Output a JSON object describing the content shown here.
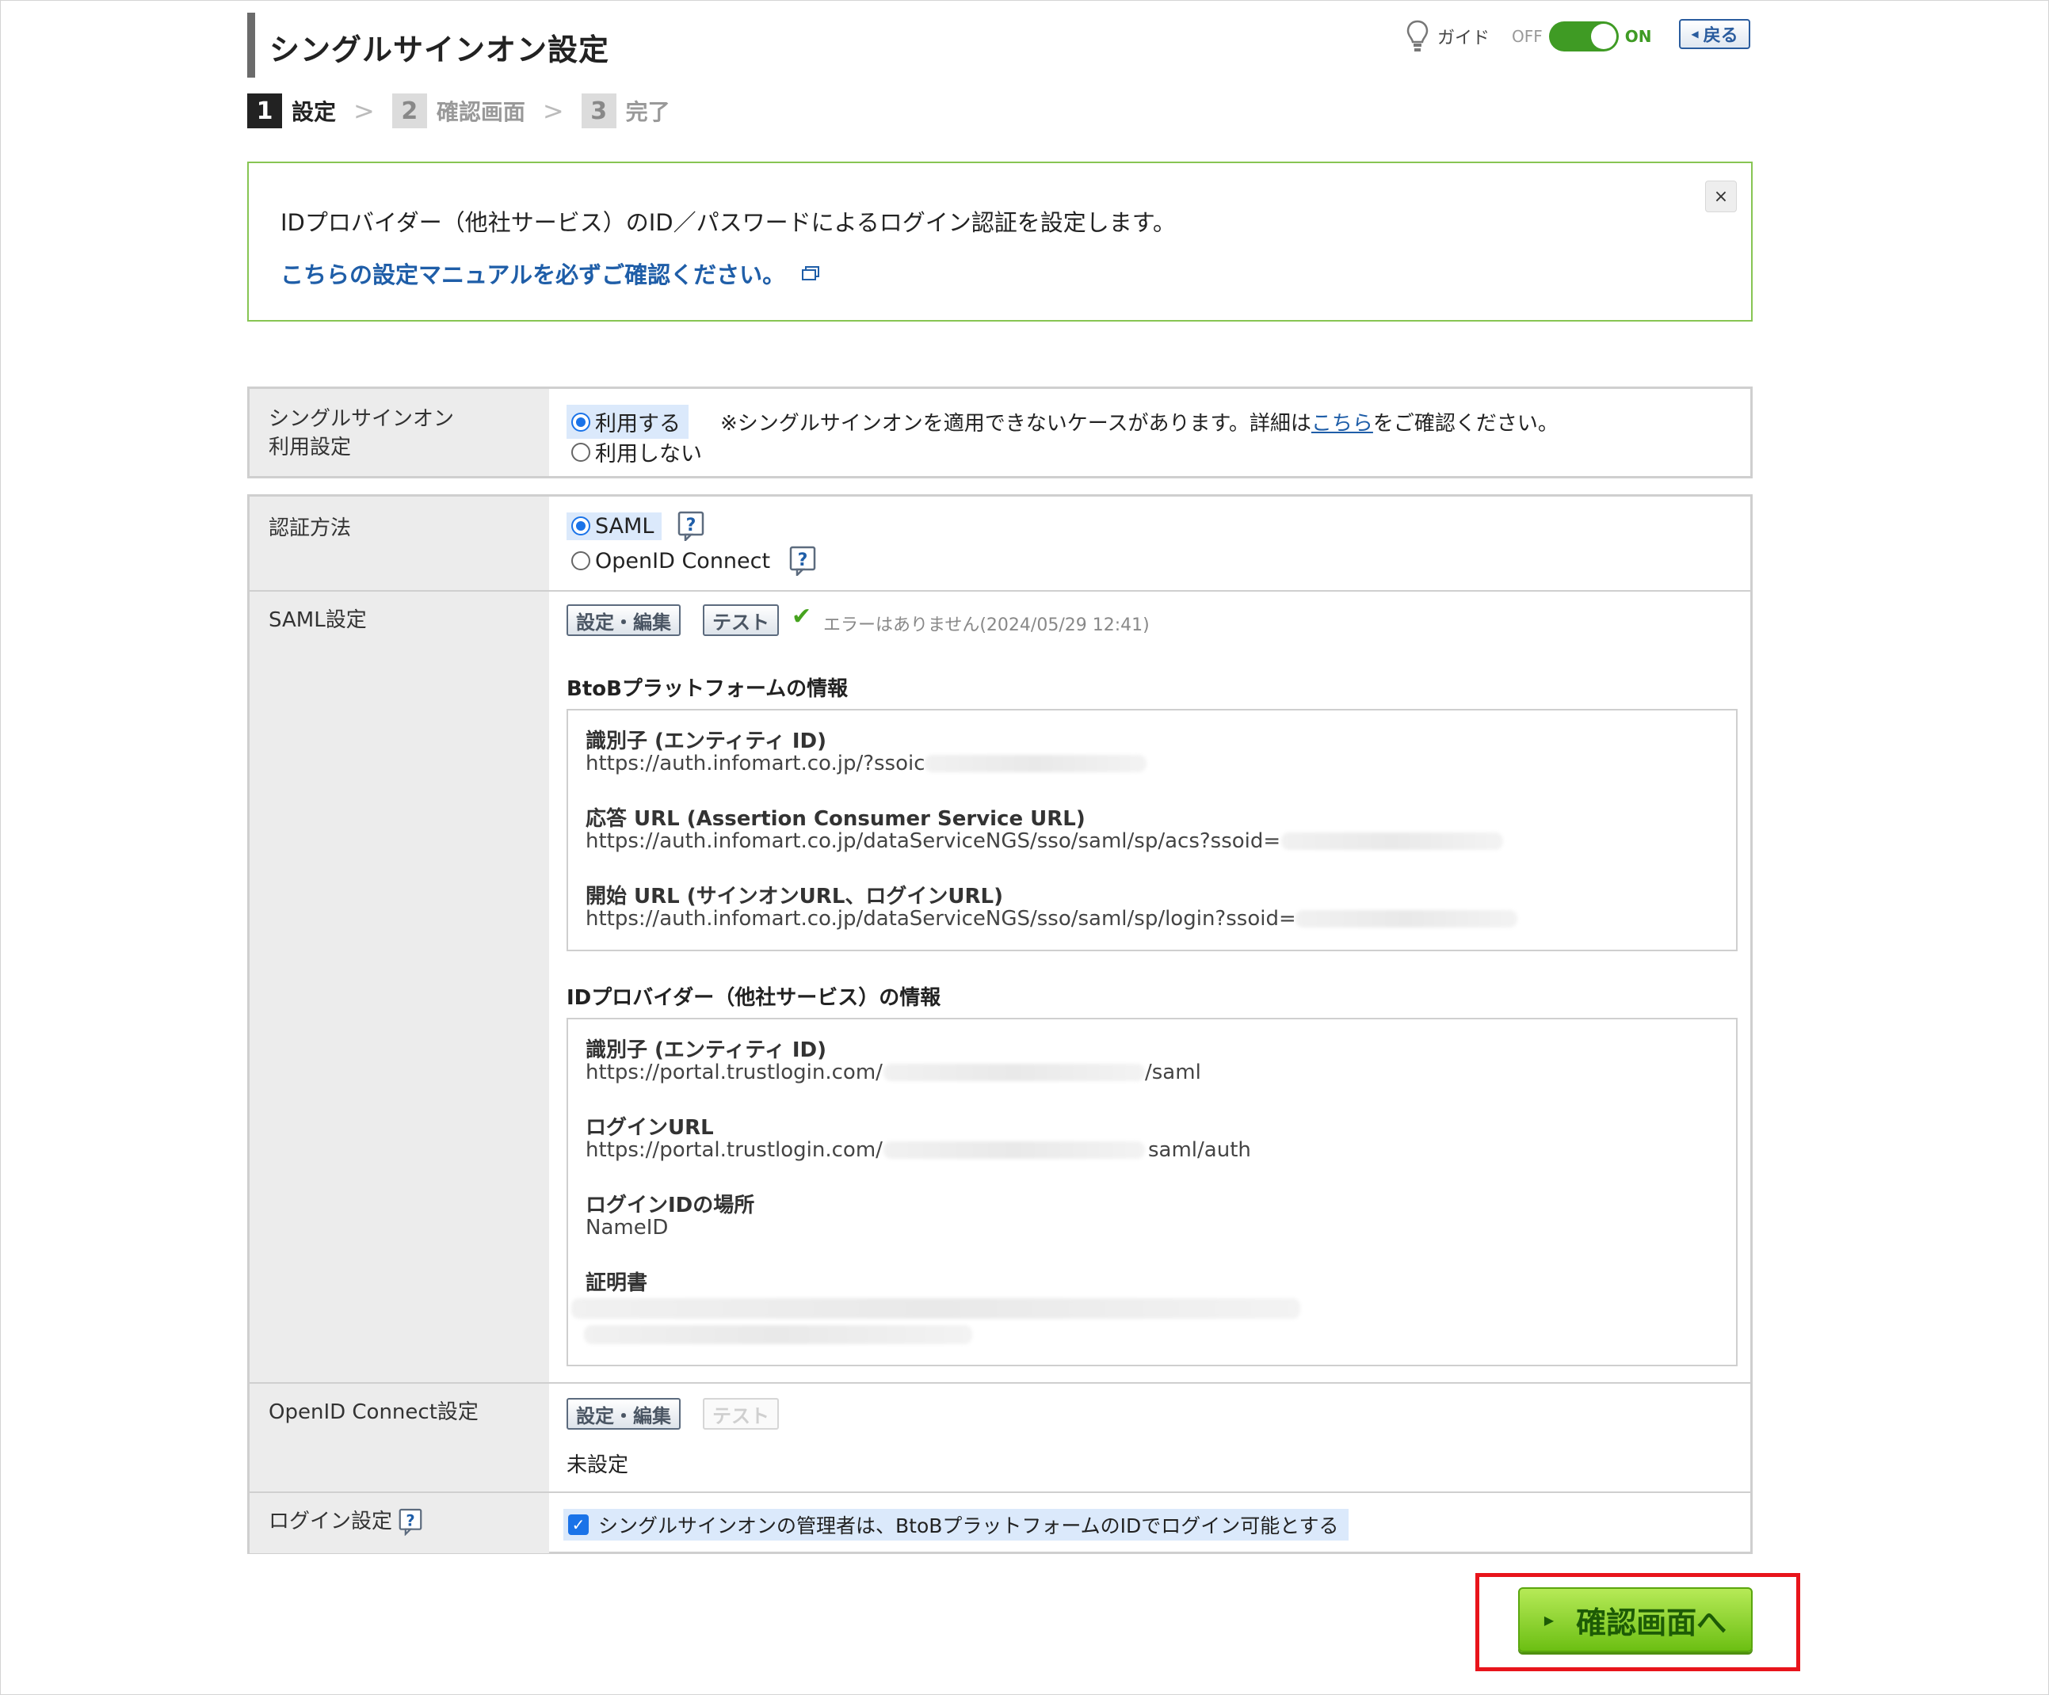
{
  "page": {
    "title": "シングルサインオン設定",
    "guide_label": "ガイド",
    "guide_off": "OFF",
    "guide_on": "ON",
    "back_label": "戻る"
  },
  "steps": [
    {
      "num": "1",
      "label": "設定",
      "active": true
    },
    {
      "num": "2",
      "label": "確認画面",
      "active": false
    },
    {
      "num": "3",
      "label": "完了",
      "active": false
    }
  ],
  "info": {
    "text": "IDプロバイダー（他社サービス）のID／パスワードによるログイン認証を設定します。",
    "link": "こちらの設定マニュアルを必ずご確認ください。",
    "close": "×"
  },
  "sso_usage": {
    "label_line1": "シングルサインオン",
    "label_line2": "利用設定",
    "option_use": "利用する",
    "option_not_use": "利用しない",
    "note_prefix": "※シングルサインオンを適用できないケースがあります。詳細は",
    "note_link": "こちら",
    "note_suffix": "をご確認ください。"
  },
  "auth_method": {
    "label": "認証方法",
    "option_saml": "SAML",
    "option_oidc": "OpenID Connect",
    "help": "?"
  },
  "saml": {
    "label": "SAML設定",
    "edit_btn": "設定・編集",
    "test_btn": "テスト",
    "status": "エラーはありません(2024/05/29 12:41)",
    "btob_title": "BtoBプラットフォームの情報",
    "btob": {
      "entity_label": "識別子 (エンティティ ID)",
      "entity_value": "https://auth.infomart.co.jp/?ssoic",
      "acs_label": "応答 URL (Assertion Consumer Service URL)",
      "acs_value": "https://auth.infomart.co.jp/dataServiceNGS/sso/saml/sp/acs?ssoid=",
      "login_label": "開始 URL (サインオンURL、ログインURL)",
      "login_value": "https://auth.infomart.co.jp/dataServiceNGS/sso/saml/sp/login?ssoid="
    },
    "idp_title": "IDプロバイダー（他社サービス）の情報",
    "idp": {
      "entity_label": "識別子 (エンティティ ID)",
      "entity_prefix": "https://portal.trustlogin.com/",
      "entity_suffix": "/saml",
      "login_url_label": "ログインURL",
      "login_url_prefix": "https://portal.trustlogin.com/",
      "login_url_suffix": "saml/auth",
      "loginid_label": "ログインIDの場所",
      "loginid_value": "NameID",
      "cert_label": "証明書"
    }
  },
  "oidc": {
    "label": "OpenID Connect設定",
    "edit_btn": "設定・編集",
    "test_btn": "テスト",
    "status": "未設定"
  },
  "login_setting": {
    "label": "ログイン設定",
    "help": "?",
    "checkbox_label": "シングルサインオンの管理者は、BtoBプラットフォームのIDでログイン可能とする",
    "checked": true
  },
  "footer": {
    "confirm_btn": "確認画面へ"
  },
  "colors": {
    "accent_green": "#87c553",
    "link_blue": "#1f5ea8",
    "highlight_red": "#e8141b",
    "button_green": "#6cbf13"
  }
}
